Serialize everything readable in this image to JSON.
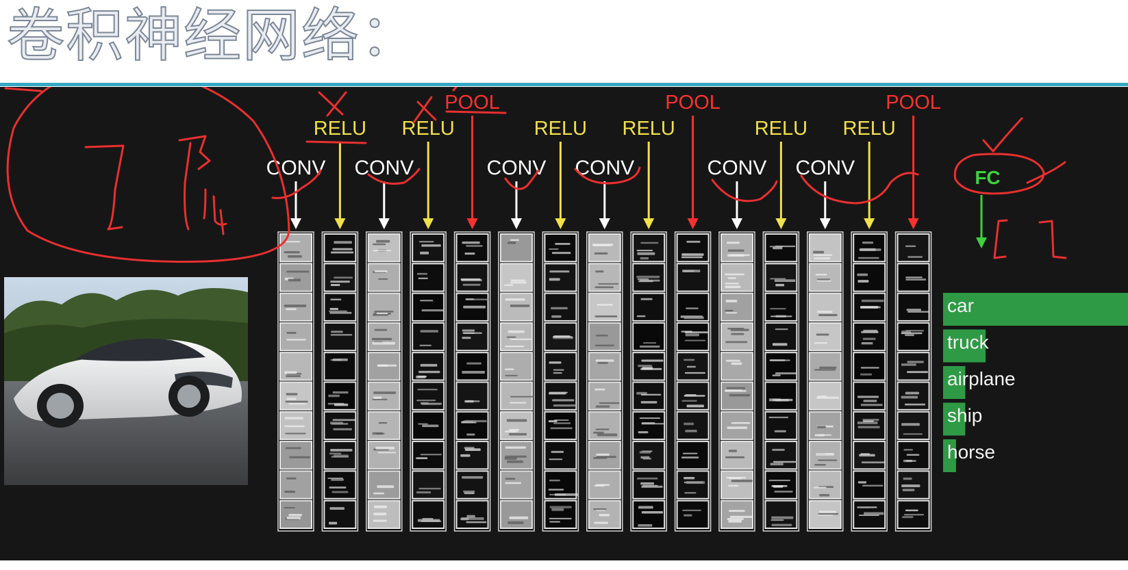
{
  "title": "卷积神经网络：",
  "layers": [
    {
      "row": "conv",
      "label": "CONV"
    },
    {
      "row": "relu",
      "label": "RELU"
    },
    {
      "row": "conv",
      "label": "CONV"
    },
    {
      "row": "relu",
      "label": "RELU"
    },
    {
      "row": "pool",
      "label": "POOL"
    },
    {
      "row": "conv",
      "label": "CONV"
    },
    {
      "row": "relu",
      "label": "RELU"
    },
    {
      "row": "conv",
      "label": "CONV"
    },
    {
      "row": "relu",
      "label": "RELU"
    },
    {
      "row": "pool",
      "label": "POOL"
    },
    {
      "row": "conv",
      "label": "CONV"
    },
    {
      "row": "relu",
      "label": "RELU"
    },
    {
      "row": "conv",
      "label": "CONV"
    },
    {
      "row": "relu",
      "label": "RELU"
    },
    {
      "row": "pool",
      "label": "POOL"
    }
  ],
  "fc": {
    "label": "FC"
  },
  "predictions": [
    {
      "label": "car",
      "score": 1.0
    },
    {
      "label": "truck",
      "score": 0.23
    },
    {
      "label": "airplane",
      "score": 0.12
    },
    {
      "label": "ship",
      "score": 0.12
    },
    {
      "label": "horse",
      "score": 0.07
    }
  ],
  "colors": {
    "conv": "#ffffff",
    "relu": "#f0e04a",
    "pool": "#ff3030",
    "fc": "#3ed13e",
    "bar": "#2e9a45",
    "ink": "#e8302f"
  }
}
